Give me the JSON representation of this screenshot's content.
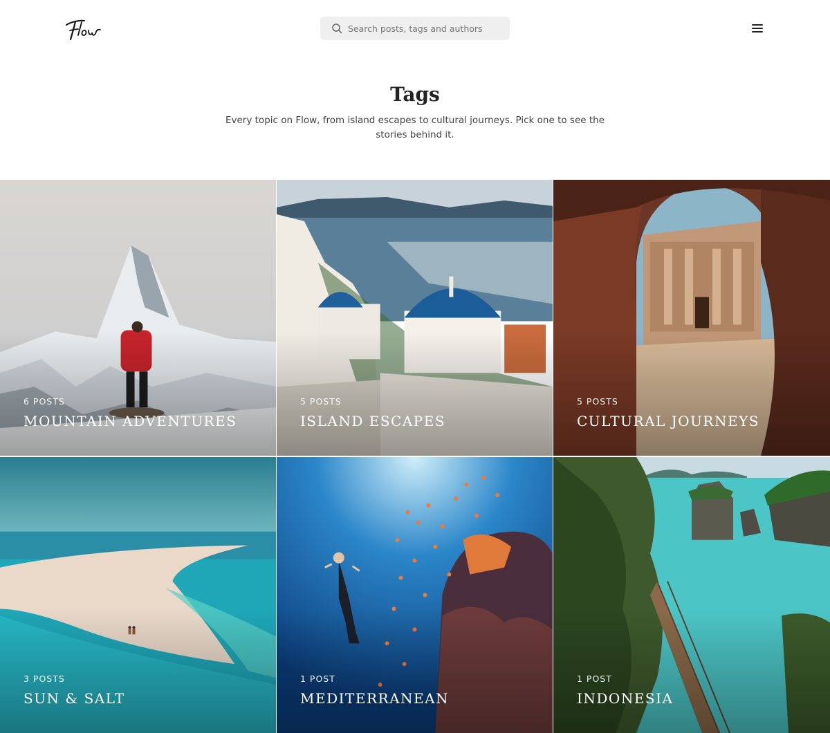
{
  "header": {
    "logo_text": "Flow",
    "search": {
      "placeholder": "Search posts, tags and authors"
    },
    "menu_icon": "hamburger-menu-icon"
  },
  "intro": {
    "title": "Tags",
    "description": "Every topic on Flow, from island escapes to cultural journeys. Pick one to see the stories behind it."
  },
  "tags": [
    {
      "count": "6 POSTS",
      "name": "MOUNTAIN ADVENTURES"
    },
    {
      "count": "5 POSTS",
      "name": "ISLAND ESCAPES"
    },
    {
      "count": "5 POSTS",
      "name": "CULTURAL JOURNEYS"
    },
    {
      "count": "3 POSTS",
      "name": "SUN & SALT"
    },
    {
      "count": "1 POST",
      "name": "MEDITERRANEAN"
    },
    {
      "count": "1 POST",
      "name": "INDONESIA"
    }
  ],
  "colors": {
    "text": "#222222",
    "search_bg": "#efefef",
    "overlay_text": "#ffffff"
  }
}
